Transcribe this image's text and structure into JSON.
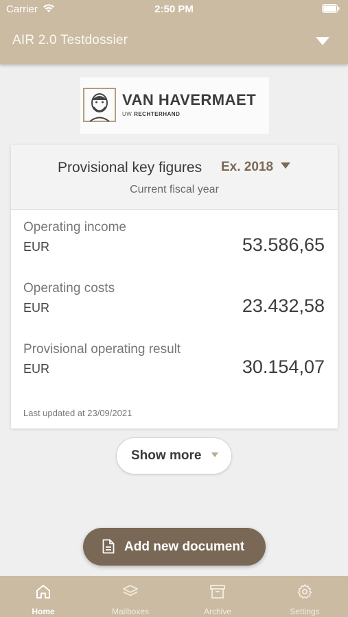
{
  "status_bar": {
    "carrier": "Carrier",
    "time": "2:50 PM"
  },
  "header": {
    "dossier_title": "AIR 2.0 Testdossier"
  },
  "logo": {
    "name": "VAN HAVERMAET",
    "tagline_prefix": "UW",
    "tagline_bold": "RECHTERHAND"
  },
  "card": {
    "title": "Provisional key figures",
    "year": "Ex. 2018",
    "subtitle": "Current fiscal year",
    "metrics": [
      {
        "label": "Operating income",
        "unit": "EUR",
        "value": "53.586,65"
      },
      {
        "label": "Operating costs",
        "unit": "EUR",
        "value": "23.432,58"
      },
      {
        "label": "Provisional operating result",
        "unit": "EUR",
        "value": "30.154,07"
      }
    ],
    "last_updated": "Last updated at 23/09/2021"
  },
  "show_more_label": "Show more",
  "add_document_label": "Add new document",
  "tabs": [
    {
      "label": "Home",
      "icon": "home-icon",
      "active": true
    },
    {
      "label": "Mailboxes",
      "icon": "layers-icon",
      "active": false
    },
    {
      "label": "Archive",
      "icon": "archive-box-icon",
      "active": false
    },
    {
      "label": "Settings",
      "icon": "gear-icon",
      "active": false
    }
  ],
  "colors": {
    "brand_beige": "#cbbba2",
    "primary_brown": "#7a6856",
    "accent_text": "#7a6a55"
  }
}
